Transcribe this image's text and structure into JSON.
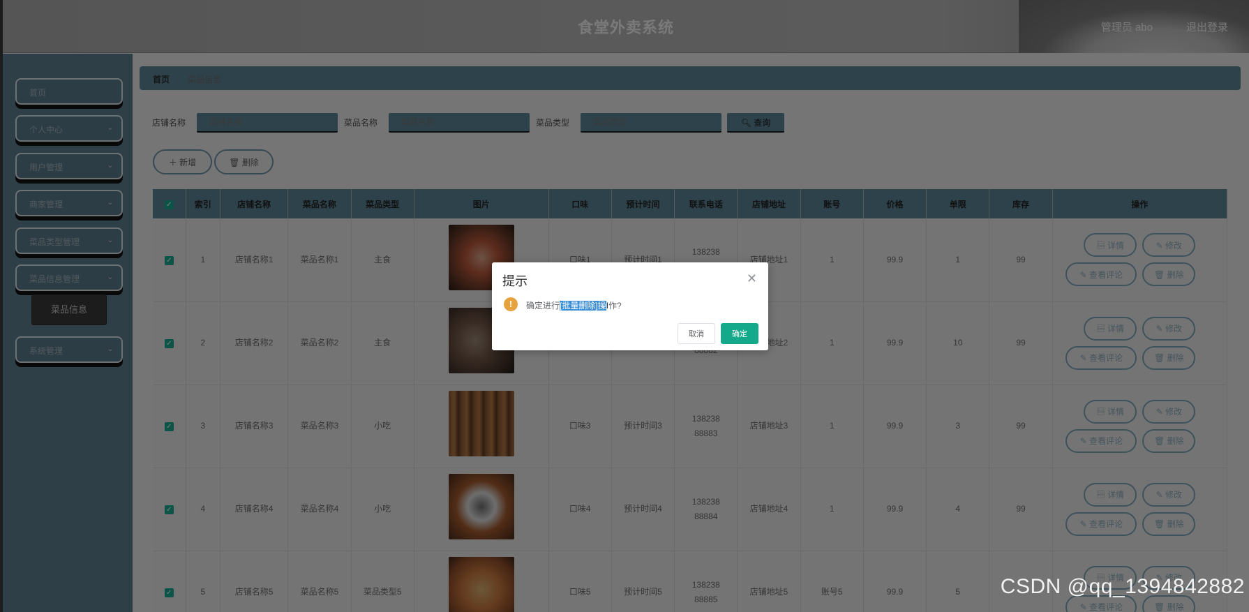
{
  "header": {
    "title": "食堂外卖系统",
    "user": "管理员 abo",
    "logout": "退出登录"
  },
  "sidebar": {
    "items": [
      {
        "label": "首页",
        "chevron": false
      },
      {
        "label": "个人中心",
        "chevron": true
      },
      {
        "label": "用户管理",
        "chevron": true
      },
      {
        "label": "商家管理",
        "chevron": true
      },
      {
        "label": "菜品类型管理",
        "chevron": true
      },
      {
        "label": "菜品信息管理",
        "chevron": true
      },
      {
        "label": "系统管理",
        "chevron": true
      }
    ],
    "sub_item": "菜品信息"
  },
  "breadcrumb": {
    "home": "首页",
    "current": "菜品信息"
  },
  "search": {
    "shop_label": "店铺名称",
    "shop_placeholder": "店铺名称",
    "dish_label": "菜品名称",
    "dish_placeholder": "菜品名称",
    "type_label": "菜品类型",
    "type_placeholder": "菜品类型",
    "query_label": "查询"
  },
  "actions": {
    "add": "新增",
    "delete": "删除"
  },
  "table": {
    "headers": [
      "索引",
      "店铺名称",
      "菜品名称",
      "菜品类型",
      "图片",
      "口味",
      "预计时间",
      "联系电话",
      "店铺地址",
      "账号",
      "价格",
      "单限",
      "库存",
      "操作"
    ],
    "rows": [
      {
        "idx": "1",
        "shop": "店铺名称1",
        "dish": "菜品名称1",
        "type": "主食",
        "taste": "口味1",
        "time": "预计时间1",
        "phone": "13823888881",
        "addr": "店铺地址1",
        "account": "1",
        "price": "99.9",
        "limit": "1",
        "stock": "99"
      },
      {
        "idx": "2",
        "shop": "店铺名称2",
        "dish": "菜品名称2",
        "type": "主食",
        "taste": "口味2",
        "time": "预计时间2",
        "phone": "13823888882",
        "addr": "店铺地址2",
        "account": "1",
        "price": "99.9",
        "limit": "10",
        "stock": "99"
      },
      {
        "idx": "3",
        "shop": "店铺名称3",
        "dish": "菜品名称3",
        "type": "小吃",
        "taste": "口味3",
        "time": "预计时间3",
        "phone": "13823888883",
        "addr": "店铺地址3",
        "account": "1",
        "price": "99.9",
        "limit": "3",
        "stock": "99"
      },
      {
        "idx": "4",
        "shop": "店铺名称4",
        "dish": "菜品名称4",
        "type": "小吃",
        "taste": "口味4",
        "time": "预计时间4",
        "phone": "13823888884",
        "addr": "店铺地址4",
        "account": "1",
        "price": "99.9",
        "limit": "4",
        "stock": "99"
      },
      {
        "idx": "5",
        "shop": "店铺名称5",
        "dish": "菜品名称5",
        "type": "菜品类型5",
        "taste": "口味5",
        "time": "预计时间5",
        "phone": "13823888885",
        "addr": "店铺地址5",
        "account": "账号5",
        "price": "99.9",
        "limit": "5",
        "stock": ""
      }
    ],
    "ops": {
      "detail": "详情",
      "edit": "修改",
      "review": "查看评论",
      "delete": "删除"
    }
  },
  "dialog": {
    "title": "提示",
    "msg_pre": "确定进行",
    "msg_highlight": "[批量删除]操",
    "msg_post": "作?",
    "cancel": "取消",
    "confirm": "确定"
  },
  "watermark": "CSDN @qq_1394842882"
}
